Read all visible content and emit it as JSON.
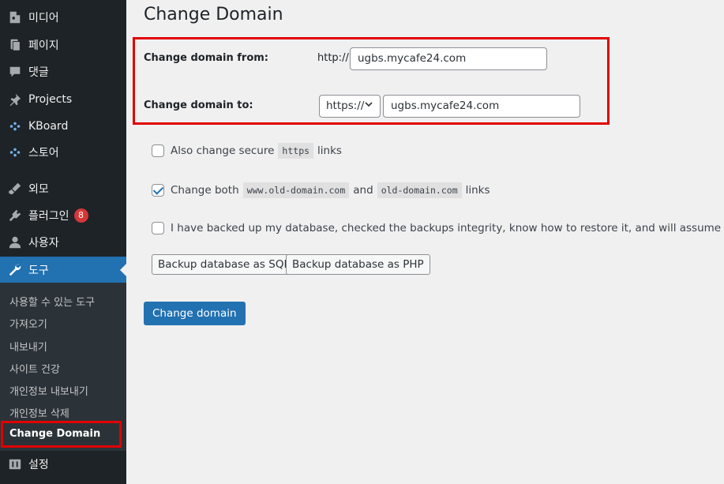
{
  "sidebar": {
    "items": [
      {
        "label": "미디어",
        "icon": "media-icon"
      },
      {
        "label": "페이지",
        "icon": "page-icon"
      },
      {
        "label": "댓글",
        "icon": "comment-icon"
      },
      {
        "label": "Projects",
        "icon": "pin-icon"
      },
      {
        "label": "KBoard",
        "icon": "kboard-icon"
      },
      {
        "label": "스토어",
        "icon": "store-icon"
      },
      {
        "label": "외모",
        "icon": "appearance-icon"
      },
      {
        "label": "플러그인",
        "icon": "plugin-icon",
        "badge": "8"
      },
      {
        "label": "사용자",
        "icon": "user-icon"
      },
      {
        "label": "도구",
        "icon": "wrench-icon",
        "active": true
      },
      {
        "label": "설정",
        "icon": "settings-icon"
      }
    ],
    "submenu": [
      {
        "label": "사용할 수 있는 도구"
      },
      {
        "label": "가져오기"
      },
      {
        "label": "내보내기"
      },
      {
        "label": "사이트 건강"
      },
      {
        "label": "개인정보 내보내기"
      },
      {
        "label": "개인정보 삭제"
      },
      {
        "label": "Change Domain",
        "current": true
      }
    ]
  },
  "main": {
    "title": "Change Domain",
    "from": {
      "label": "Change domain from:",
      "prefix": "http://",
      "value": "ugbs.mycafe24.com"
    },
    "to": {
      "label": "Change domain to:",
      "protocol": "https://",
      "value": "ugbs.mycafe24.com"
    },
    "options": {
      "secure": {
        "before": "Also change secure",
        "code": "https",
        "after": "links",
        "checked": false
      },
      "both": {
        "before": "Change both",
        "code1": "www.old-domain.com",
        "mid": "and",
        "code2": "old-domain.com",
        "after": "links",
        "checked": true
      },
      "backup": {
        "text": "I have backed up my database, checked the backups integrity, know how to restore it, and will assume the respons",
        "checked": false
      }
    },
    "buttons": {
      "backup_sql": "Backup database as SQL",
      "backup_php": "Backup database as PHP",
      "change": "Change domain"
    }
  },
  "colors": {
    "accent": "#2271b1",
    "sidebar_bg": "#1d2327",
    "highlight": "#e00000",
    "badge": "#d63638"
  }
}
